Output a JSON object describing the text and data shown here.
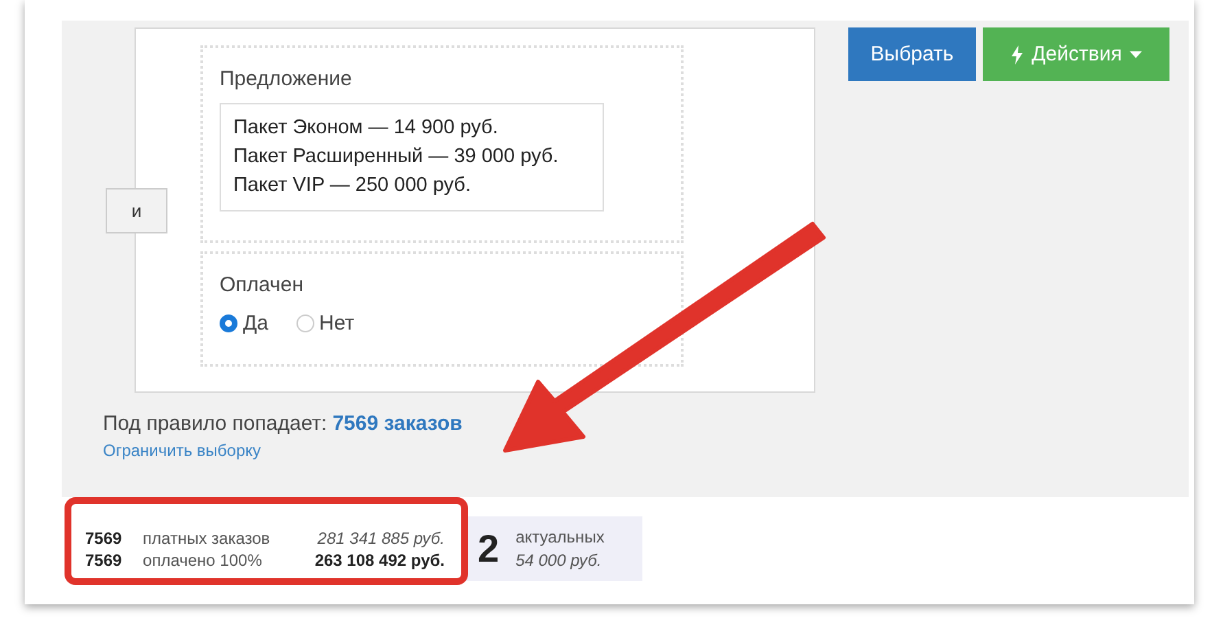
{
  "join_button": "и",
  "offer": {
    "label": "Предложение",
    "items": [
      "Пакет Эконом — 14 900 руб.",
      "Пакет Расширенный — 39 000 руб.",
      "Пакет VIP — 250 000 руб."
    ]
  },
  "paid": {
    "label": "Оплачен",
    "options": [
      {
        "label": "Да",
        "selected": true
      },
      {
        "label": "Нет",
        "selected": false
      }
    ]
  },
  "buttons": [
    {
      "label": "Выбрать",
      "kind": "primary"
    },
    {
      "label": "Действия",
      "kind": "actions"
    }
  ],
  "match": {
    "prefix": "Под правило попадает:",
    "link": "7569 заказов"
  },
  "limit_link": "Ограничить выборку",
  "stats": [
    {
      "count": "7569",
      "label": "платных заказов",
      "amount": "281 341 885 руб.",
      "emphasis": false
    },
    {
      "count": "7569",
      "label": "оплачено 100%",
      "amount": "263 108 492 руб.",
      "emphasis": true
    }
  ],
  "active": {
    "count": "2",
    "label": "актуальных",
    "amount": "54 000 руб."
  }
}
